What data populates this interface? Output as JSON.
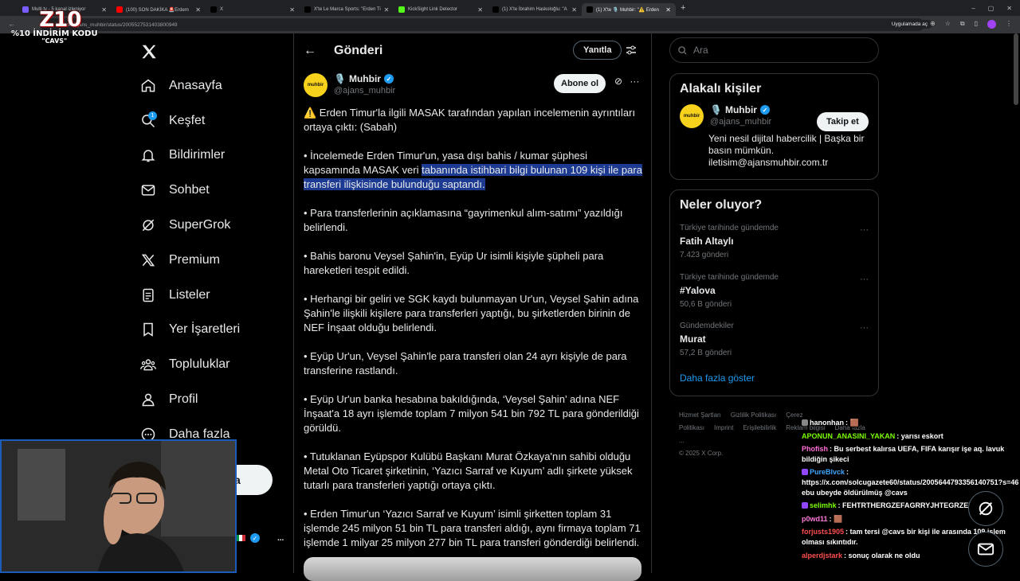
{
  "browser": {
    "tabs": [
      {
        "label": "Multi tv - 5 kanal izleniyor",
        "color": "#7b5cff",
        "active": false
      },
      {
        "label": "(100) SON DAKİKA 🚨Erdem",
        "color": "#ff0000",
        "active": false
      },
      {
        "label": "X",
        "color": "#000000",
        "active": false
      },
      {
        "label": "X'te Le Marca Sports: \"Erden Ti",
        "color": "#000000",
        "active": false
      },
      {
        "label": "KickSight Link Detector",
        "color": "#53fc18",
        "active": false
      },
      {
        "label": "(1) X'te İbrahim Haskoloğlu: \"A",
        "color": "#000000",
        "active": false
      },
      {
        "label": "(1) X'te 🎙️ Muhbir: \"⚠️ Erden",
        "color": "#000000",
        "active": true
      }
    ],
    "new_tab": "+",
    "url": ".com/ajans_muhbir/status/2005527531403800949",
    "open_app": "Uygulamada aç",
    "promo": {
      "big": "Z10",
      "line1": "%10 İNDİRİM KODU",
      "line2": "\"CAVS\""
    }
  },
  "sidebar": {
    "items": [
      {
        "label": "Anasayfa",
        "icon": "home-icon"
      },
      {
        "label": "Keşfet",
        "icon": "search-icon"
      },
      {
        "label": "Bildirimler",
        "icon": "bell-icon"
      },
      {
        "label": "Sohbet",
        "icon": "mail-icon"
      },
      {
        "label": "SuperGrok",
        "icon": "grok-icon"
      },
      {
        "label": "Premium",
        "icon": "x-icon"
      },
      {
        "label": "Listeler",
        "icon": "list-icon"
      },
      {
        "label": "Yer İşaretleri",
        "icon": "bookmark-icon"
      },
      {
        "label": "Topluluklar",
        "icon": "community-icon"
      },
      {
        "label": "Profil",
        "icon": "person-icon"
      },
      {
        "label": "Daha fazla",
        "icon": "more-icon"
      }
    ],
    "notification_badge": "1",
    "post_button_fragment": "a",
    "account_more": "..."
  },
  "post": {
    "header_title": "Gönderi",
    "reply_label": "Yanıtla",
    "author_name": "Muhbir",
    "author_handle": "@ajans_muhbir",
    "avatar_text": "muhbir",
    "follow_label": "Abone ol",
    "paragraphs": [
      {
        "pre": "⚠️ Erden Timur'la ilgili MASAK tarafından yapılan incelemenin ayrıntıları ortaya çıktı: (Sabah)",
        "hl": "",
        "post": ""
      },
      {
        "pre": "• İncelemede Erden Timur'un, yasa dışı bahis / kumar şüphesi kapsamında MASAK veri ",
        "hl": "tabanında istihbari bilgi bulunan 109 kişi ile para transferi ilişkisinde bulunduğu saptandı.",
        "post": ""
      },
      {
        "pre": "• Para transferlerinin açıklamasına “gayrimenkul alım-satımı” yazıldığı belirlendi.",
        "hl": "",
        "post": ""
      },
      {
        "pre": "• Bahis baronu Veysel Şahin'in, Eyüp Ur isimli kişiyle şüpheli para hareketleri tespit edildi.",
        "hl": "",
        "post": ""
      },
      {
        "pre": "• Herhangi bir geliri ve SGK kaydı bulunmayan Ur'un, Veysel Şahin adına Şahin'le ilişkili kişilere para transferleri yaptığı, bu şirketlerden birinin de NEF İnşaat olduğu belirlendi.",
        "hl": "",
        "post": ""
      },
      {
        "pre": "• Eyüp Ur'un, Veysel Şahin'le para transferi olan 24 ayrı kişiyle de para transferine rastlandı.",
        "hl": "",
        "post": ""
      },
      {
        "pre": "• Eyüp Ur'un banka hesabına bakıldığında, ‘Veysel Şahin’ adına NEF İnşaat'a 18 ayrı işlemde toplam 7 milyon 541 bin 792 TL para gönderildiği görüldü.",
        "hl": "",
        "post": ""
      },
      {
        "pre": "• Tutuklanan Eyüpspor Kulübü Başkanı Murat Özkaya'nın sahibi olduğu Metal Oto Ticaret şirketinin, ‘Yazıcı Sarraf ve Kuyum’ adlı şirkete yüksek tutarlı para transferleri yaptığı ortaya çıktı.",
        "hl": "",
        "post": ""
      },
      {
        "pre": "• Erden Timur'un ‘Yazıcı Sarraf ve Kuyum’ isimli şirketten toplam 31 işlemde 245 milyon 51 bin TL para transferi aldığı, aynı firmaya toplam 71 işlemde 1 milyar 25 milyon 277 bin TL para transferi gönderdiği belirlendi.",
        "hl": "",
        "post": ""
      }
    ]
  },
  "right": {
    "search_placeholder": "Ara",
    "related_title": "Alakalı kişiler",
    "related": {
      "name": "Muhbir",
      "handle": "@ajans_muhbir",
      "follow": "Takip et",
      "bio": "Yeni nesil dijital habercilik | Başka bir basın mümkün. iletisim@ajansmuhbir.com.tr"
    },
    "trends_title": "Neler oluyor?",
    "trends": [
      {
        "context": "Türkiye tarihinde gündemde",
        "name": "Fatih Altaylı",
        "count": "7.423 gönderi"
      },
      {
        "context": "Türkiye tarihinde gündemde",
        "name": "#Yalova",
        "count": "50,6 B gönderi"
      },
      {
        "context": "Gündemdekiler",
        "name": "Murat",
        "count": "57,2 B gönderi"
      }
    ],
    "show_more": "Daha fazla göster",
    "footer_links": [
      "Hizmet Şartları",
      "Gizlilik Politikası",
      "Çerez Politikası",
      "Imprint",
      "Erişilebilirlik",
      "Reklam bilgisi",
      "Daha fazla ..."
    ],
    "copyright": "© 2025 X Corp."
  },
  "chat": [
    {
      "user": "hanonhan",
      "msg": "🟫",
      "color": "#ffffff",
      "icon": "#888888"
    },
    {
      "user": "APONUN_ANASINI_YAKAN",
      "msg": "yarısı eskort",
      "color": "#7cfc00",
      "icon": ""
    },
    {
      "user": "Phofish",
      "msg": "Bu serbest kalırsa UEFA, FIFA karışır işe aq. lavuk bildiğin şikeci",
      "color": "#ff6fd8",
      "icon": ""
    },
    {
      "user": "PureBlvck",
      "msg": "https://x.com/solcugazete60/status/2005644793356140751?s=46 ebu ubeyde öldürülmüş @cavs",
      "color": "#3ea6ff",
      "icon": "#9146ff"
    },
    {
      "user": "selimhk",
      "msg": "FEHTRTHERGZEFAGRRYJHTEGRZEF",
      "color": "#7cfc00",
      "icon": "#9146ff"
    },
    {
      "user": "p0wd11",
      "msg": "🟫",
      "color": "#ff7ad9",
      "icon": ""
    },
    {
      "user": "forjusts1905",
      "msg": "tam tersi @cavs bir kişi ile arasında 109 işlem olması sıkıntıdır.",
      "color": "#ff4d4d",
      "icon": ""
    },
    {
      "user": "alperdjstark",
      "msg": "sonuç olarak ne oldu",
      "color": "#ff4d4d",
      "icon": ""
    }
  ]
}
